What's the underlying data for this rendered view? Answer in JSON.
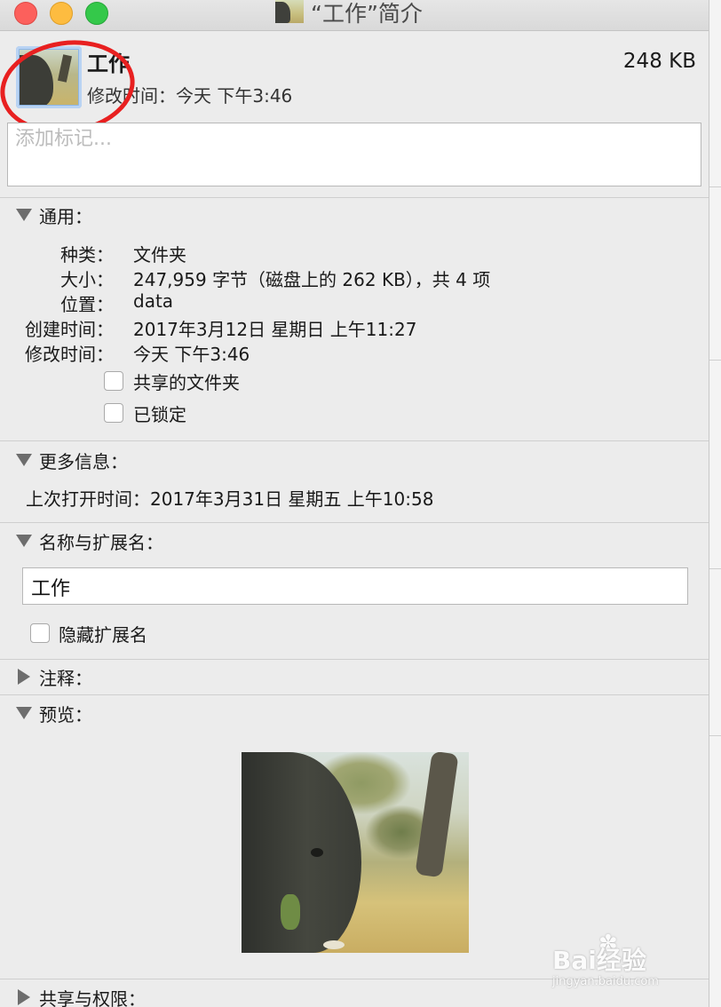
{
  "window": {
    "title": "“工作”简介"
  },
  "header": {
    "name": "工作",
    "modified": "修改时间：今天 下午3:46",
    "size": "248 KB"
  },
  "tags": {
    "placeholder": "添加标记..."
  },
  "general": {
    "label": "通用：",
    "rows": [
      {
        "key": "种类：",
        "value": "文件夹"
      },
      {
        "key": "大小：",
        "value": "247,959 字节（磁盘上的 262 KB），共 4 项"
      },
      {
        "key": "位置：",
        "value": "data"
      },
      {
        "key": "创建时间：",
        "value": "2017年3月12日 星期日 上午11:27"
      },
      {
        "key": "修改时间：",
        "value": "今天 下午3:46"
      }
    ],
    "shared_folder_label": "共享的文件夹",
    "shared_folder_checked": false,
    "locked_label": "已锁定",
    "locked_checked": false
  },
  "more_info": {
    "label": "更多信息：",
    "last_opened": "上次打开时间：2017年3月31日 星期五 上午10:58"
  },
  "name_ext": {
    "label": "名称与扩展名：",
    "value": "工作",
    "hide_ext_label": "隐藏扩展名",
    "hide_ext_checked": false
  },
  "comments": {
    "label": "注释："
  },
  "preview": {
    "label": "预览："
  },
  "sharing": {
    "label": "共享与权限："
  },
  "watermark": {
    "brand": "Bai经验",
    "url": "jingyan.baidu.com"
  }
}
